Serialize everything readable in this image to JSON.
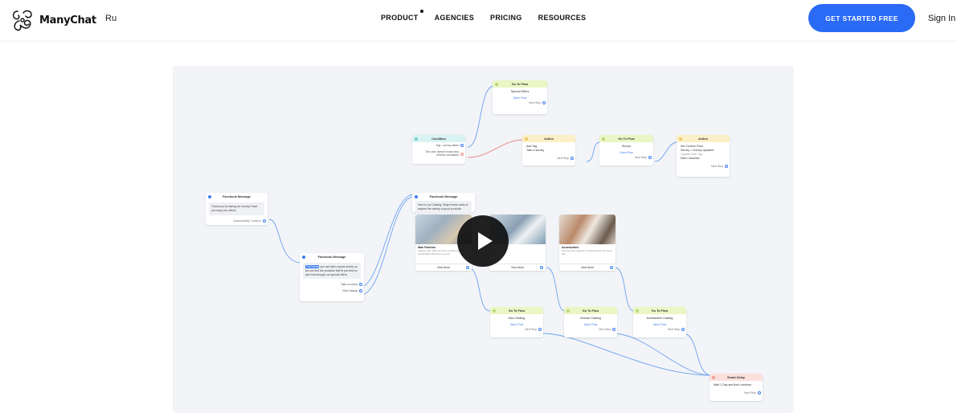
{
  "header": {
    "brand": "ManyChat",
    "lang": "Ru",
    "nav": [
      "PRODUCT",
      "AGENCIES",
      "PRICING",
      "RESOURCES"
    ],
    "cta": "GET STARTED FREE",
    "signin": "Sign In"
  },
  "colors": {
    "accent": "#2a6af5",
    "canvas_bg": "#f2f4f7",
    "connector": "#6ea2ef",
    "connector_red": "#e98a82"
  },
  "icons": [
    "manychat-logo-icon",
    "play-icon",
    "messenger-icon",
    "condition-icon",
    "action-icon",
    "go-to-flow-icon",
    "smart-delay-icon"
  ],
  "flow": {
    "goto_special": {
      "title": "Go To Flow",
      "name": "Special Offers",
      "link": "Open Flow",
      "foot": "Next Step"
    },
    "condition": {
      "title": "Condition",
      "line1": "Tag = survey taken",
      "line2": "The user doesn't match any",
      "line3": "of these conditions"
    },
    "action1": {
      "title": "Action",
      "line1": "Add Tag",
      "line2": "Take a survey",
      "foot": "Next Step"
    },
    "goto_survey": {
      "title": "Go To Flow",
      "name": "Survey",
      "link": "Open Flow",
      "foot": "Next Step"
    },
    "action2": {
      "title": "Action",
      "line1": "Set Custom Field",
      "line2": "Survey = Survey Updated",
      "line3": "Update User Tag",
      "line4": "New Customer",
      "foot": "Next Step"
    },
    "fb_msg1": {
      "title": "Facebook Message",
      "text": "Thank you for taking our survey! Have you enjoy our offers!",
      "foot": "Automatically Continue"
    },
    "fb_msg2": {
      "title": "Facebook Message",
      "text": "you can take a quick survey so we can find the products that fit you best or just look through our special offers.",
      "highlight": "Full Name",
      "opt1": "Take a survey",
      "opt2": "Visit Catalog"
    },
    "fb_msg3": {
      "title": "Facebook Message",
      "text": "Here is our Catalog. Swipe these cards to explore the variety of good products",
      "card1": {
        "title": "Man Fashion",
        "sub": "Clothes that make you feel confident and comfortable wherever you are",
        "btn": "View More"
      },
      "card2": {
        "btn": "View More"
      },
      "card3": {
        "title": "Accessories",
        "sub": "Discover the collection of accessories for every day",
        "btn": "View More"
      }
    },
    "goto_man": {
      "title": "Go To Flow",
      "name": "Man Catalog",
      "link": "Open Flow",
      "foot": "Next Step"
    },
    "goto_woman": {
      "title": "Go To Flow",
      "name": "Woman Catalog",
      "link": "Open Flow",
      "foot": "Next Step"
    },
    "goto_acc": {
      "title": "Go To Flow",
      "name": "Accessories Catalog",
      "link": "Open Flow",
      "foot": "Next Step"
    },
    "delay": {
      "title": "Smart Delay",
      "text": "Wait 1 Day and then continue",
      "foot": "Next Step"
    }
  }
}
